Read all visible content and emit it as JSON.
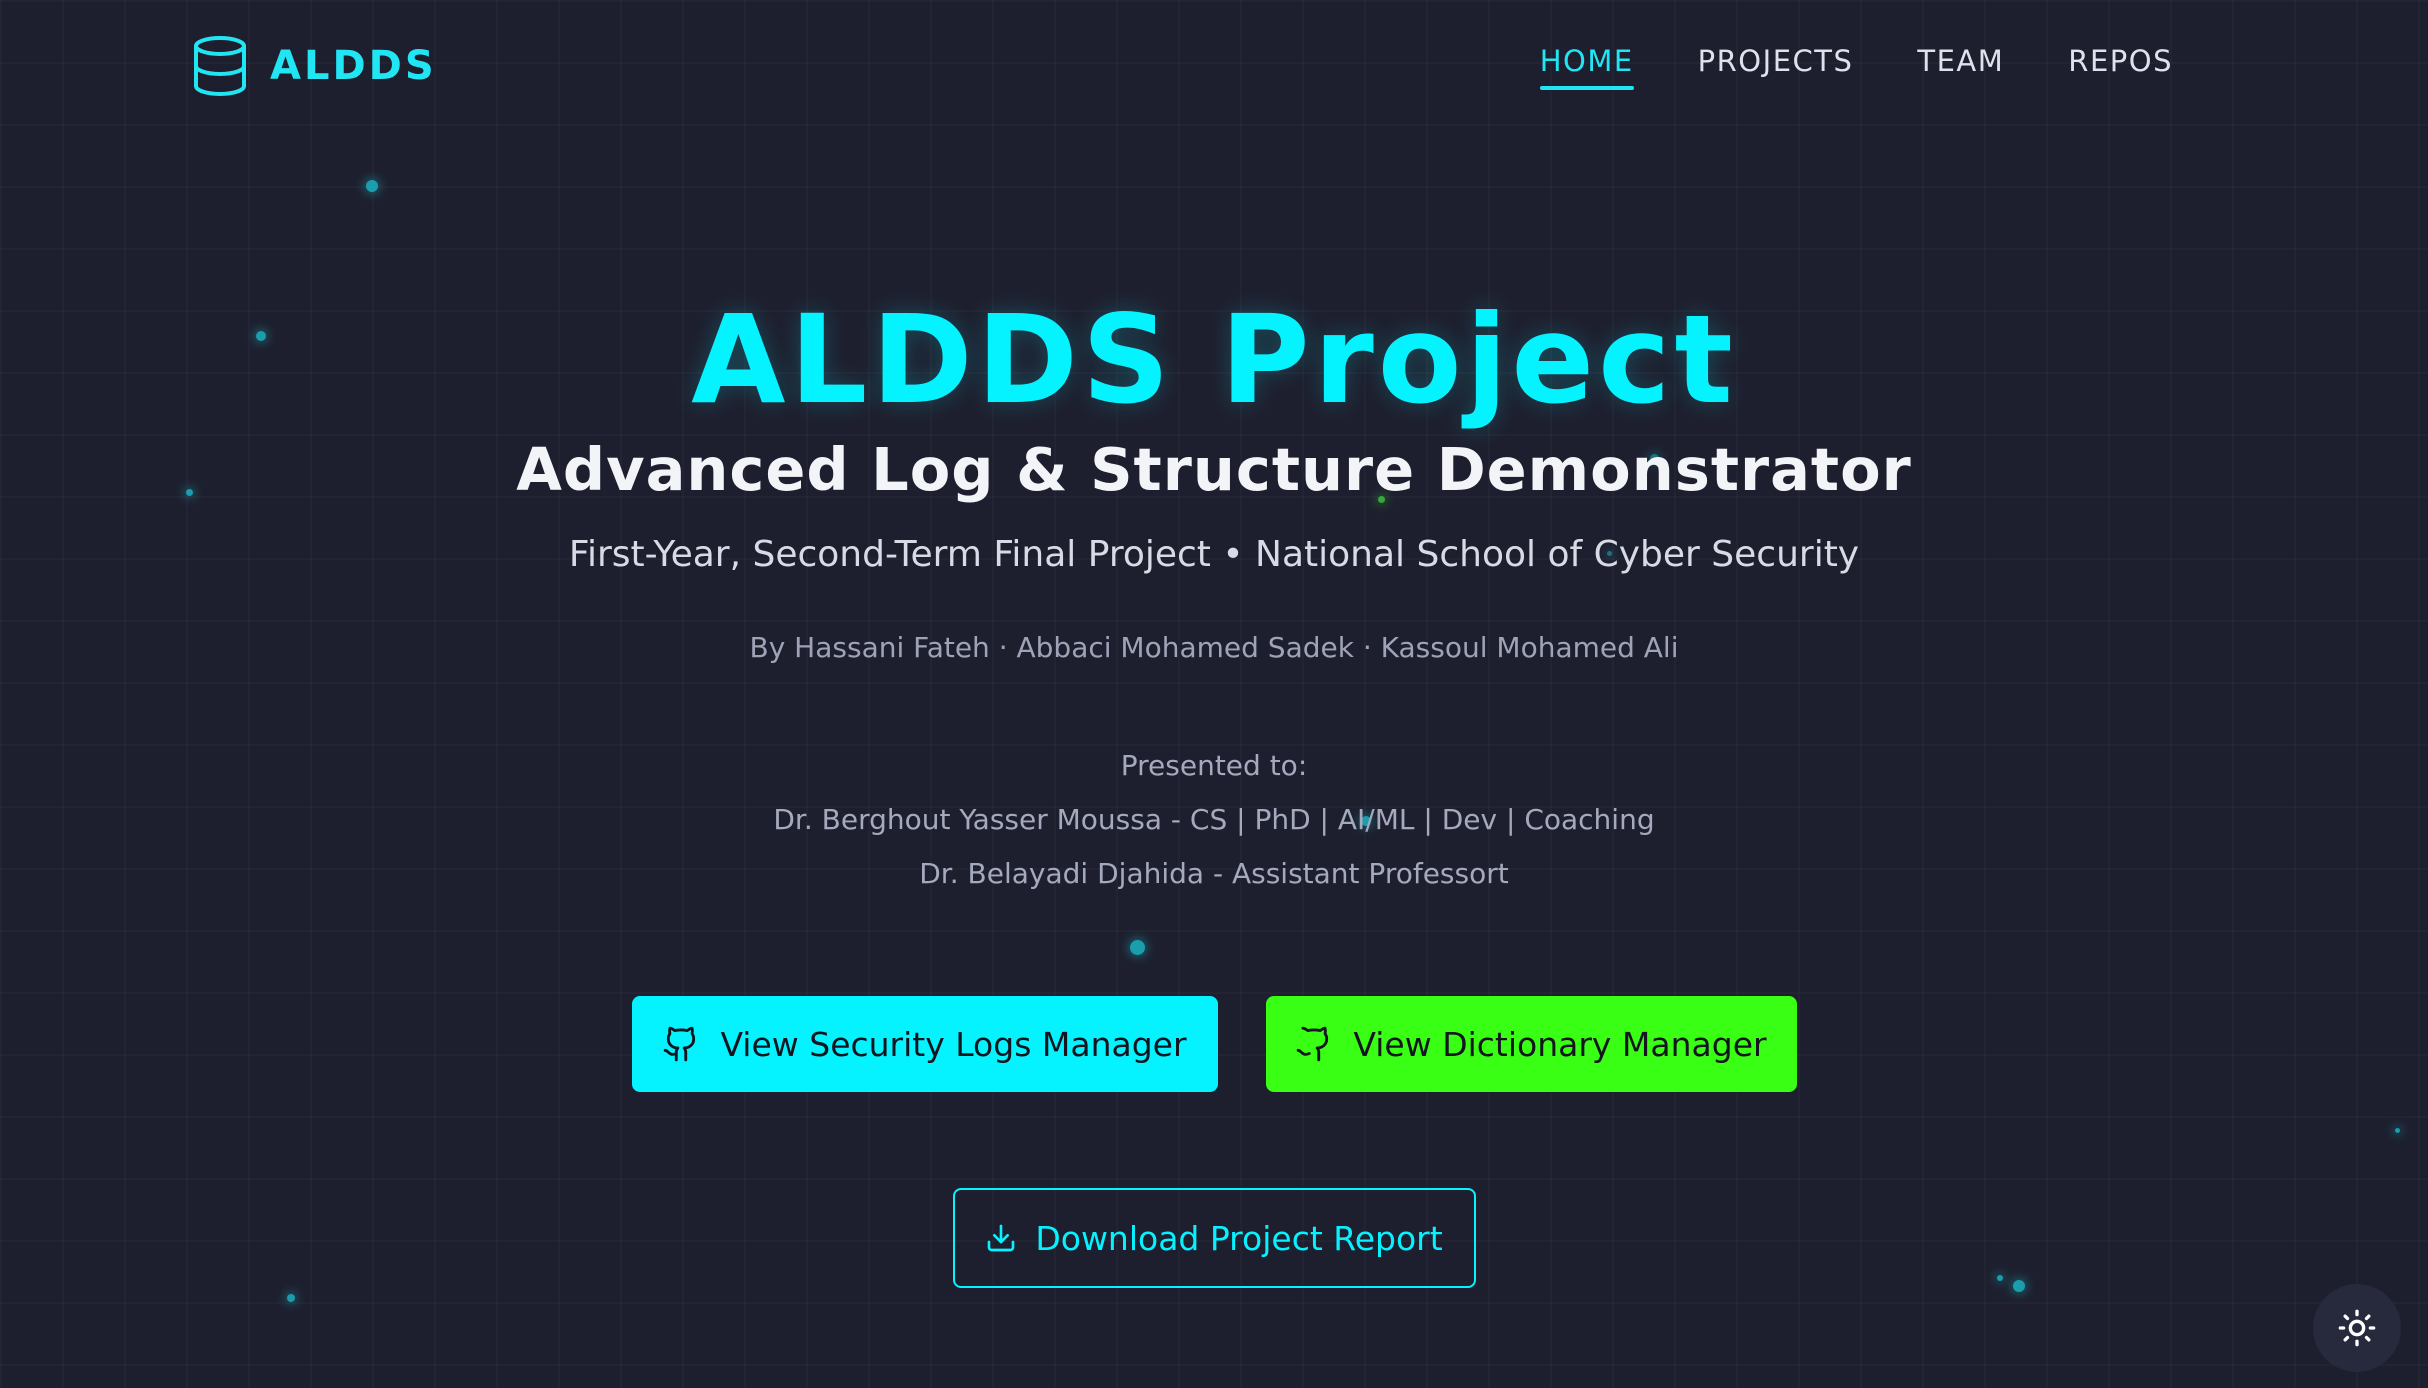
{
  "brand": {
    "icon": "database-icon",
    "name": "ALDDS"
  },
  "nav": {
    "items": [
      {
        "label": "HOME",
        "active": true
      },
      {
        "label": "PROJECTS",
        "active": false
      },
      {
        "label": "TEAM",
        "active": false
      },
      {
        "label": "REPOS",
        "active": false
      }
    ]
  },
  "hero": {
    "title": "ALDDS Project",
    "subtitle": "Advanced Log & Structure Demonstrator",
    "tagline": "First-Year, Second-Term Final Project • National School of Cyber Security",
    "authors": "By Hassani Fateh · Abbaci Mohamed Sadek · Kassoul Mohamed Ali",
    "presented_label": "Presented to:",
    "supervisors": [
      "Dr. Berghout Yasser Moussa - CS | PhD | AI/ML | Dev | Coaching",
      "Dr. Belayadi Djahida - Assistant Professort"
    ]
  },
  "buttons": {
    "logs": {
      "label": "View Security Logs Manager",
      "icon": "github-icon"
    },
    "dictionary": {
      "label": "View Dictionary Manager",
      "icon": "github-icon"
    },
    "download": {
      "label": "Download Project Report",
      "icon": "download-icon"
    }
  },
  "theme_toggle": {
    "icon": "sun-icon"
  },
  "colors": {
    "background": "#1e1f2e",
    "accent_cyan": "#05f2ff",
    "accent_green": "#39ff14",
    "text_muted": "#9ea3b8"
  }
}
